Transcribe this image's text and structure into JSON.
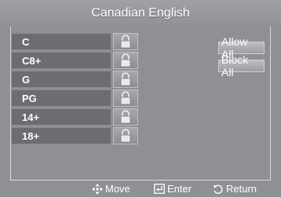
{
  "window": {
    "title": "Canadian English"
  },
  "ratings": [
    {
      "label": "C",
      "icon": "lock-open-icon"
    },
    {
      "label": "C8+",
      "icon": "lock-open-icon"
    },
    {
      "label": "G",
      "icon": "lock-open-icon"
    },
    {
      "label": "PG",
      "icon": "lock-open-icon"
    },
    {
      "label": "14+",
      "icon": "lock-open-icon"
    },
    {
      "label": "18+",
      "icon": "lock-open-icon"
    }
  ],
  "buttons": {
    "allow_all": "Allow All",
    "block_all": "Block All"
  },
  "footer": {
    "move": {
      "label": "Move",
      "icon": "move-arrows-icon"
    },
    "enter": {
      "label": "Enter",
      "icon": "enter-icon"
    },
    "return": {
      "label": "Return",
      "icon": "return-icon"
    }
  },
  "colors": {
    "background": "#8e9093",
    "row_fill": "#6b6d72",
    "text": "#ffffff"
  }
}
